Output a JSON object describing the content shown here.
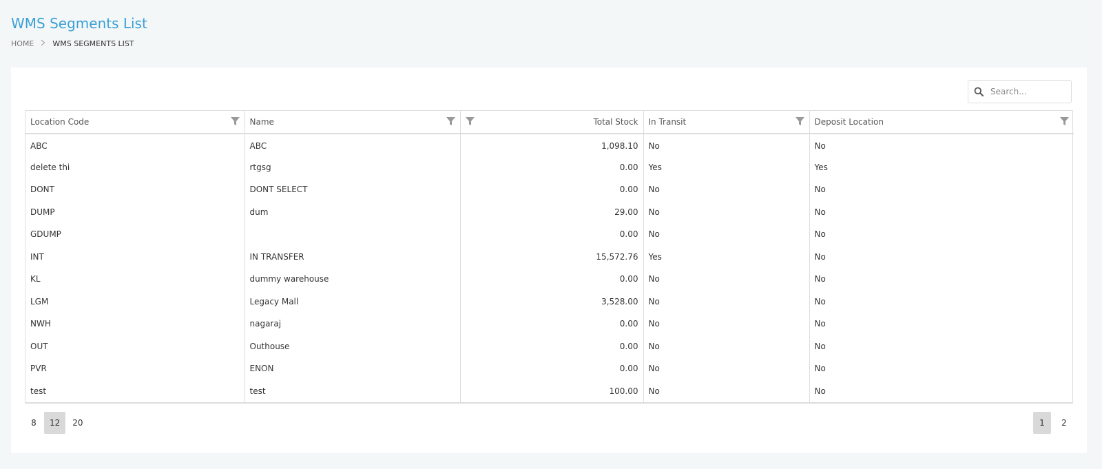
{
  "header": {
    "title": "WMS Segments List",
    "breadcrumb": {
      "home": "HOME",
      "current": "WMS SEGMENTS LIST"
    }
  },
  "search": {
    "placeholder": "Search...",
    "value": ""
  },
  "table": {
    "columns": {
      "location_code": "Location Code",
      "name": "Name",
      "total_stock": "Total Stock",
      "in_transit": "In Transit",
      "deposit_location": "Deposit Location"
    },
    "rows": [
      {
        "location_code": "ABC",
        "name": "ABC",
        "total_stock": "1,098.10",
        "in_transit": "No",
        "deposit_location": "No"
      },
      {
        "location_code": "delete thi",
        "name": "rtgsg",
        "total_stock": "0.00",
        "in_transit": "Yes",
        "deposit_location": "Yes"
      },
      {
        "location_code": "DONT",
        "name": "DONT SELECT",
        "total_stock": "0.00",
        "in_transit": "No",
        "deposit_location": "No"
      },
      {
        "location_code": "DUMP",
        "name": "dum",
        "total_stock": "29.00",
        "in_transit": "No",
        "deposit_location": "No"
      },
      {
        "location_code": "GDUMP",
        "name": "",
        "total_stock": "0.00",
        "in_transit": "No",
        "deposit_location": "No"
      },
      {
        "location_code": "INT",
        "name": "IN TRANSFER",
        "total_stock": "15,572.76",
        "in_transit": "Yes",
        "deposit_location": "No"
      },
      {
        "location_code": "KL",
        "name": "dummy warehouse",
        "total_stock": "0.00",
        "in_transit": "No",
        "deposit_location": "No"
      },
      {
        "location_code": "LGM",
        "name": "Legacy Mall",
        "total_stock": "3,528.00",
        "in_transit": "No",
        "deposit_location": "No"
      },
      {
        "location_code": "NWH",
        "name": "nagaraj",
        "total_stock": "0.00",
        "in_transit": "No",
        "deposit_location": "No"
      },
      {
        "location_code": "OUT",
        "name": "Outhouse",
        "total_stock": "0.00",
        "in_transit": "No",
        "deposit_location": "No"
      },
      {
        "location_code": "PVR",
        "name": "ENON",
        "total_stock": "0.00",
        "in_transit": "No",
        "deposit_location": "No"
      },
      {
        "location_code": "test",
        "name": "test",
        "total_stock": "100.00",
        "in_transit": "No",
        "deposit_location": "No"
      }
    ]
  },
  "pager": {
    "page_sizes": [
      "8",
      "12",
      "20"
    ],
    "selected_page_size": "12",
    "pages": [
      "1",
      "2"
    ],
    "current_page": "1"
  },
  "colors": {
    "title": "#3aa0d6",
    "background": "#f4f7f8",
    "active_pager": "#d9d9d9"
  },
  "icons": {
    "search": "search-icon",
    "filter": "filter-icon",
    "breadcrumb_separator": "chevron-right-icon"
  }
}
